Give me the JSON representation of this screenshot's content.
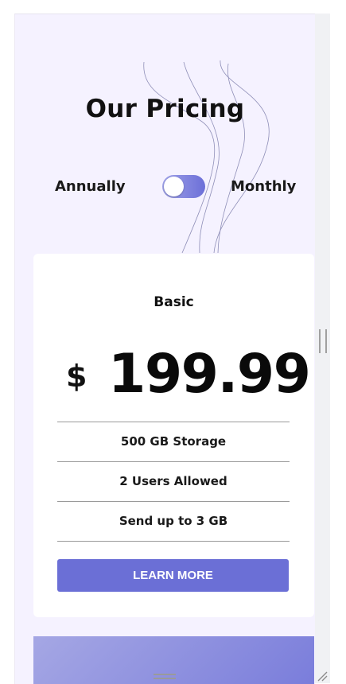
{
  "header": {
    "title": "Our Pricing"
  },
  "billing_toggle": {
    "left_label": "Annually",
    "right_label": "Monthly",
    "state": "annually",
    "accent_color": "#6c6fd8"
  },
  "plan": {
    "name": "Basic",
    "currency": "$",
    "price": "199.99",
    "features": [
      "500 GB Storage",
      "2 Users Allowed",
      "Send up to 3 GB"
    ],
    "cta_label": "LEARN MORE",
    "cta_color": "#6b6fd6"
  },
  "icons": {
    "vertical_resize": "vertical-resize-grip-icon",
    "horizontal_resize": "horizontal-resize-grip-icon",
    "corner_resize": "corner-resize-icon"
  }
}
